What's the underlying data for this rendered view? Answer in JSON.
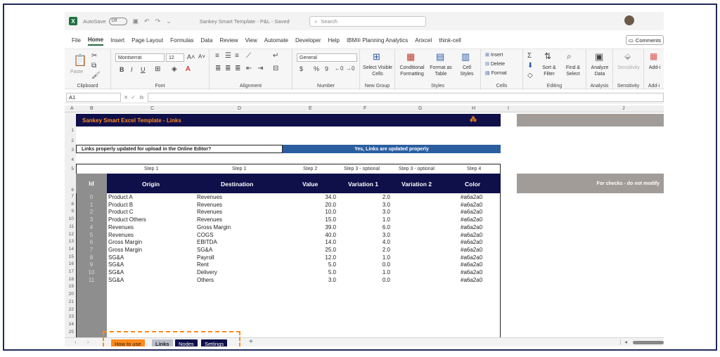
{
  "titlebar": {
    "autosave_label": "AutoSave",
    "autosave_state": "Off",
    "document_title": "Sankey Smart Template - P&L - Saved",
    "search_placeholder": "Search"
  },
  "menu": {
    "tabs": [
      "File",
      "Home",
      "Insert",
      "Page Layout",
      "Formulas",
      "Data",
      "Review",
      "View",
      "Automate",
      "Developer",
      "Help",
      "IBM® Planning Analytics",
      "Arixcel",
      "think-cell"
    ],
    "active": "Home",
    "comments_label": "Comments"
  },
  "ribbon": {
    "clipboard": {
      "paste": "Paste",
      "label": "Clipboard"
    },
    "font": {
      "name": "Montserrat",
      "size": "12",
      "bold": "B",
      "italic": "I",
      "underline": "U",
      "label": "Font"
    },
    "alignment": {
      "label": "Alignment"
    },
    "number": {
      "format": "General",
      "currency": "$",
      "percent": "%",
      "comma": "9",
      "label": "Number"
    },
    "new_group": {
      "button": "Select Visible Cells",
      "label": "New Group"
    },
    "styles": {
      "conditional": "Conditional Formatting",
      "format_table": "Format as Table",
      "cell_styles": "Cell Styles",
      "label": "Styles"
    },
    "cells": {
      "insert": "Insert",
      "delete": "Delete",
      "format": "Format",
      "label": "Cells"
    },
    "editing": {
      "sort": "Sort & Filter",
      "find": "Find & Select",
      "label": "Editing"
    },
    "analysis": {
      "button": "Analyze Data",
      "label": "Analysis"
    },
    "sensitivity": {
      "button": "Sensitivity",
      "label": "Sensitivity"
    },
    "addins": {
      "button": "Add-i",
      "label": "Add-i"
    }
  },
  "formula_bar": {
    "name_box": "A1",
    "fx": "fx"
  },
  "columns": [
    "A",
    "B",
    "C",
    "D",
    "E",
    "F",
    "G",
    "H",
    "I",
    "J"
  ],
  "rows": [
    "1",
    "2",
    "3",
    "4",
    "5",
    "6",
    "7",
    "8",
    "9",
    "10",
    "11",
    "12",
    "13",
    "14",
    "15",
    "16",
    "17",
    "18",
    "19",
    "20",
    "21",
    "22",
    "23",
    "24",
    "25"
  ],
  "sheet": {
    "banner_title": "Sankey Smart Excel Template - Links",
    "question": "Links properly updated for upload in the Online Editor?",
    "answer": "Yes, Links are updated properly",
    "steps": [
      "Step 1",
      "Step 1",
      "Step 2",
      "Step 3 - optional",
      "Step 3 - optional",
      "Step 4"
    ],
    "headers": [
      "Id",
      "Origin",
      "Destination",
      "Value",
      "Variation 1",
      "Variation 2",
      "Color"
    ],
    "checks_label": "For checks - do not modify",
    "rows": [
      {
        "id": "0",
        "origin": "Product A",
        "dest": "Revenues",
        "value": "34.0",
        "var1": "2.0",
        "color": "#a6a2a0"
      },
      {
        "id": "1",
        "origin": "Product B",
        "dest": "Revenues",
        "value": "20.0",
        "var1": "3.0",
        "color": "#a6a2a0"
      },
      {
        "id": "2",
        "origin": "Product C",
        "dest": "Revenues",
        "value": "10.0",
        "var1": "3.0",
        "color": "#a6a2a0"
      },
      {
        "id": "3",
        "origin": "Product Others",
        "dest": "Revenues",
        "value": "15.0",
        "var1": "1.0",
        "color": "#a6a2a0"
      },
      {
        "id": "4",
        "origin": "Revenues",
        "dest": "Gross Margin",
        "value": "39.0",
        "var1": "6.0",
        "color": "#a6a2a0"
      },
      {
        "id": "5",
        "origin": "Revenues",
        "dest": "COGS",
        "value": "40.0",
        "var1": "3.0",
        "color": "#a6a2a0"
      },
      {
        "id": "6",
        "origin": "Gross Margin",
        "dest": "EBITDA",
        "value": "14.0",
        "var1": "4.0",
        "color": "#a6a2a0"
      },
      {
        "id": "7",
        "origin": "Gross Margin",
        "dest": "SG&A",
        "value": "25.0",
        "var1": "2.0",
        "color": "#a6a2a0"
      },
      {
        "id": "8",
        "origin": "SG&A",
        "dest": "Payroll",
        "value": "12.0",
        "var1": "1.0",
        "color": "#a6a2a0"
      },
      {
        "id": "9",
        "origin": "SG&A",
        "dest": "Rent",
        "value": "5.0",
        "var1": "0.0",
        "color": "#a6a2a0"
      },
      {
        "id": "10",
        "origin": "SG&A",
        "dest": "Delivery",
        "value": "5.0",
        "var1": "1.0",
        "color": "#a6a2a0"
      },
      {
        "id": "11",
        "origin": "SG&A",
        "dest": "Others",
        "value": "3.0",
        "var1": "0.0",
        "color": "#a6a2a0"
      }
    ]
  },
  "sheet_tabs": [
    "How to use",
    "Links",
    "Nodes",
    "Settings"
  ],
  "active_sheet": "Links",
  "colors": {
    "navy": "#0f0f4a",
    "orange": "#ff8a1a",
    "blue": "#2a5ea0",
    "grey": "#a6a2a0"
  }
}
